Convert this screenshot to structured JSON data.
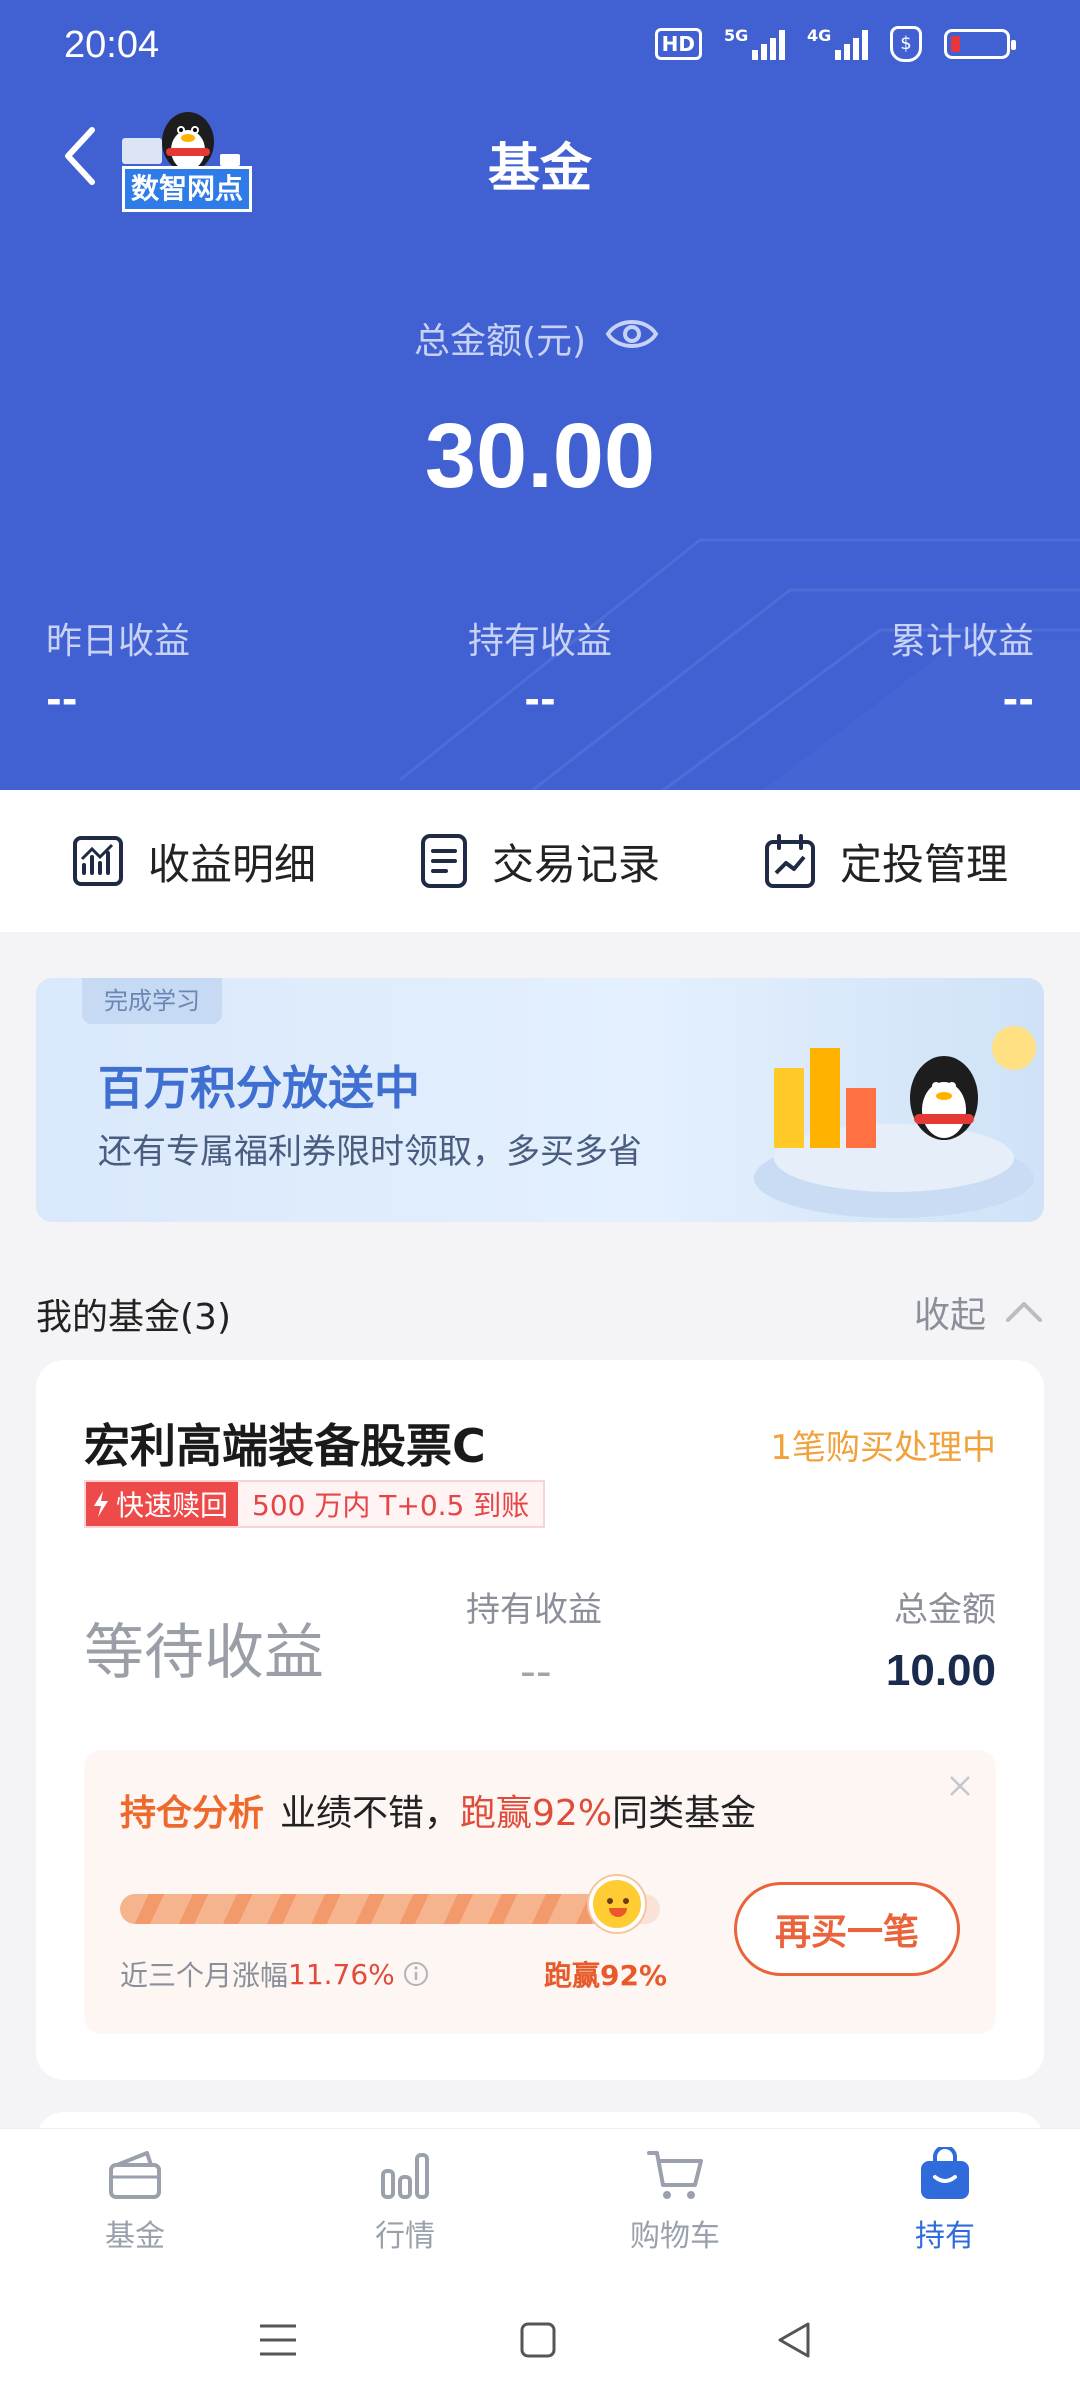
{
  "status_bar": {
    "time": "20:04",
    "hd": "HD",
    "net1": "5G",
    "net2": "4G"
  },
  "header": {
    "title": "基金",
    "logo_text": "数智网点",
    "total_label": "总金额(元)",
    "total_amount": "30.00",
    "stats": [
      {
        "label": "昨日收益",
        "value": "--"
      },
      {
        "label": "持有收益",
        "value": "--"
      },
      {
        "label": "累计收益",
        "value": "--"
      }
    ]
  },
  "actions": [
    {
      "label": "收益明细",
      "icon": "chart-icon"
    },
    {
      "label": "交易记录",
      "icon": "document-icon"
    },
    {
      "label": "定投管理",
      "icon": "calendar-icon"
    }
  ],
  "banner": {
    "tag": "完成学习",
    "title": "百万积分放送中",
    "subtitle": "还有专属福利券限时领取，多买多省"
  },
  "funds": {
    "title": "我的基金(3)",
    "collapse_label": "收起"
  },
  "fund_card": {
    "name": "宏利高端装备股票C",
    "status": "1笔购买处理中",
    "redeem_tag": "快速赎回",
    "redeem_desc": "500 万内 T+0.5 到账",
    "waiting": "等待收益",
    "hold_label": "持有收益",
    "hold_value": "--",
    "total_label": "总金额",
    "total_value": "10.00",
    "analysis": {
      "tag": "持仓分析",
      "text_before": "业绩不错，",
      "highlight": "跑赢92%",
      "text_after": "同类基金",
      "progress": 0.92,
      "rise_label": "近三个月涨幅",
      "rise_value": "11.76%",
      "beat_label": "跑赢92%",
      "buy_again": "再买一笔"
    }
  },
  "tabbar": [
    {
      "label": "基金",
      "active": false
    },
    {
      "label": "行情",
      "active": false
    },
    {
      "label": "购物车",
      "active": false
    },
    {
      "label": "持有",
      "active": true
    }
  ],
  "colors": {
    "header_bg": "#4161d3",
    "accent": "#2f6bdb",
    "orange": "#e9643a"
  }
}
